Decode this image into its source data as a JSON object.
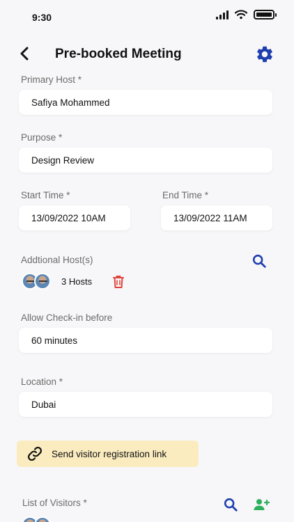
{
  "status_bar": {
    "time": "9:30"
  },
  "header": {
    "title": "Pre-booked Meeting"
  },
  "form": {
    "primary_host": {
      "label": "Primary Host *",
      "value": "Safiya Mohammed"
    },
    "purpose": {
      "label": "Purpose *",
      "value": "Design Review"
    },
    "start_time": {
      "label": "Start Time *",
      "value": "13/09/2022 10AM"
    },
    "end_time": {
      "label": "End Time *",
      "value": "13/09/2022 11AM"
    },
    "additional_hosts": {
      "label": "Addtional Host(s)",
      "count_text": "3 Hosts"
    },
    "allow_checkin": {
      "label": "Allow Check-in before",
      "value": "60 minutes"
    },
    "location": {
      "label": "Location *",
      "value": "Dubai"
    }
  },
  "send_link": {
    "label": "Send visitor registration link"
  },
  "visitors": {
    "label": "List of Visitors *"
  },
  "colors": {
    "accent": "#1f3fae",
    "delete": "#e0443c",
    "add_user": "#2eaf5d",
    "link_bg": "#fbecc0"
  },
  "icons": [
    "back-arrow-icon",
    "gear-icon",
    "search-icon",
    "trash-icon",
    "link-icon",
    "add-user-icon"
  ]
}
